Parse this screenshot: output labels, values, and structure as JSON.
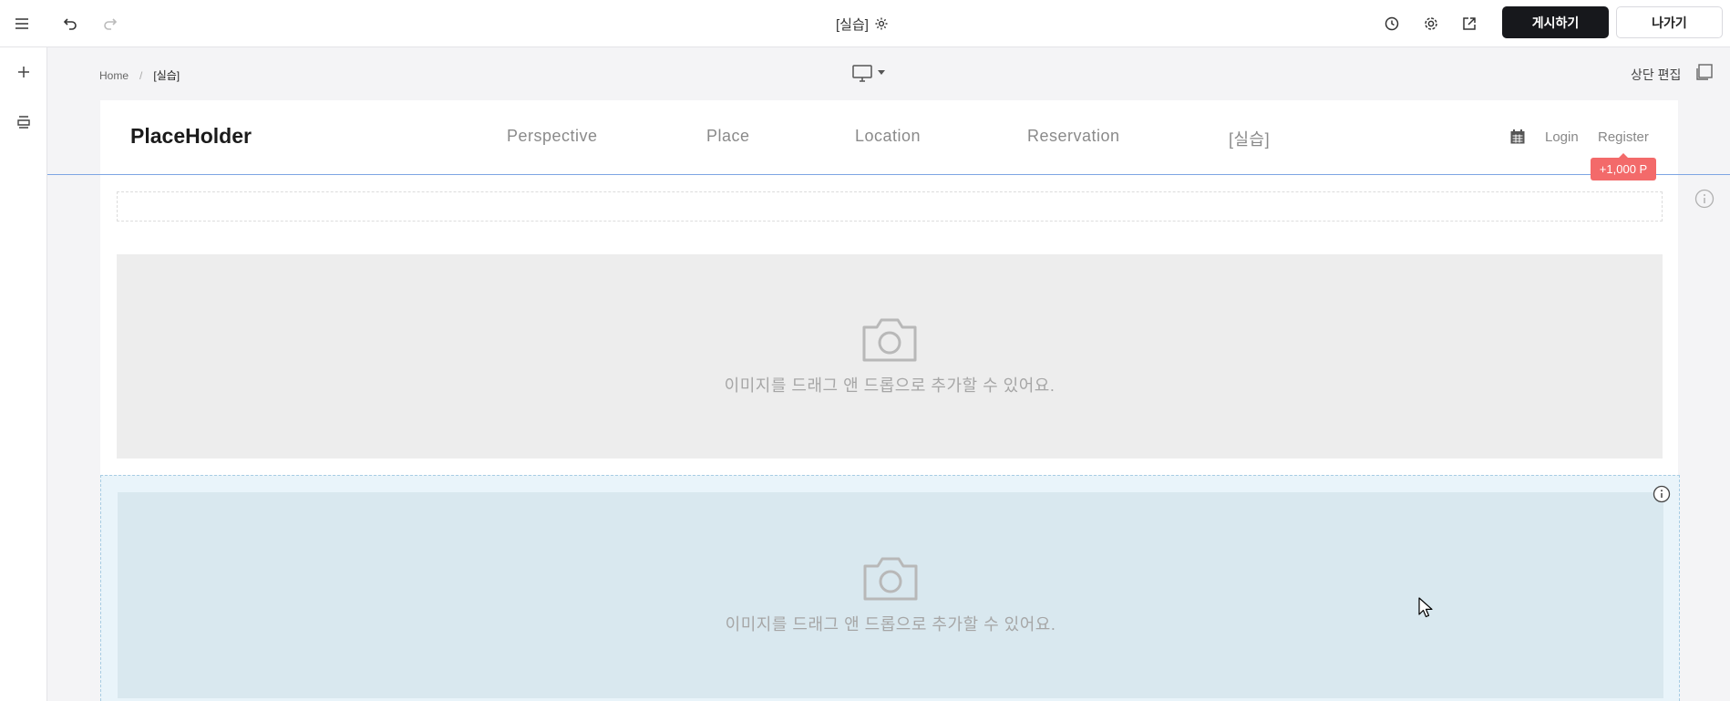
{
  "topbar": {
    "document_title": "[실습]",
    "publish_label": "게시하기",
    "exit_label": "나가기"
  },
  "canvas": {
    "breadcrumb": {
      "home": "Home",
      "separator": "/",
      "current": "[실습]"
    },
    "top_edit_label": "상단 편집"
  },
  "site": {
    "logo": "PlaceHolder",
    "nav": [
      "Perspective",
      "Place",
      "Location",
      "Reservation",
      "[실습]"
    ],
    "login_label": "Login",
    "register_label": "Register",
    "points_badge": "+1,000 P"
  },
  "image_placeholder": {
    "message": "이미지를 드래그 앤 드롭으로 추가할 수 있어요."
  },
  "colors": {
    "publish_bg": "#17181c",
    "badge_bg": "#f36a6a",
    "selected_section_bg": "#e9f4fa",
    "selected_block_bg": "#d9e8ef",
    "guide_line": "#7ea6e3"
  }
}
